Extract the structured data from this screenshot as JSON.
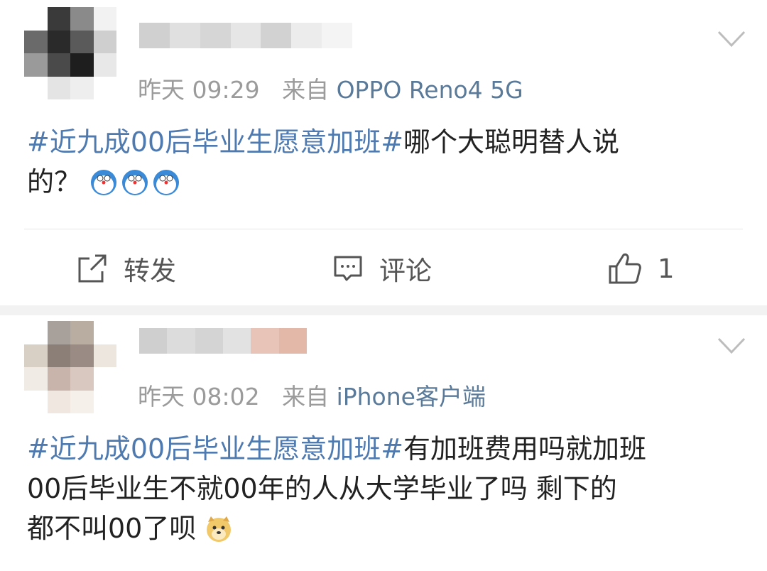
{
  "posts": [
    {
      "time": "昨天 09:29",
      "source_prefix": "来自",
      "source": "OPPO Reno4 5G",
      "hashtag": "#近九成00后毕业生愿意加班#",
      "text_line1": "哪个大聪明替人说",
      "text_line2": "的？",
      "actions": {
        "repost": "转发",
        "comment": "评论",
        "like_count": "1"
      }
    },
    {
      "time": "昨天 08:02",
      "source_prefix": "来自",
      "source": "iPhone客户端",
      "hashtag": "#近九成00后毕业生愿意加班#",
      "text_line1": "有加班费用吗就加班",
      "text_line2": "00后毕业生不就00年的人从大学毕业了吗 剩下的",
      "text_line3": "都不叫00了呗"
    }
  ],
  "icons": {
    "avatar": "blurred-avatar",
    "name": "blurred-username",
    "menu": "chevron-down-icon",
    "repost": "share-icon",
    "comment": "comment-icon",
    "like": "thumbs-up-icon",
    "emoji1": "doraemon-emoji",
    "emoji2": "doge-emoji"
  },
  "colors": {
    "hashtag": "#4f7ab0",
    "source": "#5a7a9a",
    "meta": "#9b9b9b",
    "text": "#222222",
    "separator": "#f2f2f2"
  }
}
